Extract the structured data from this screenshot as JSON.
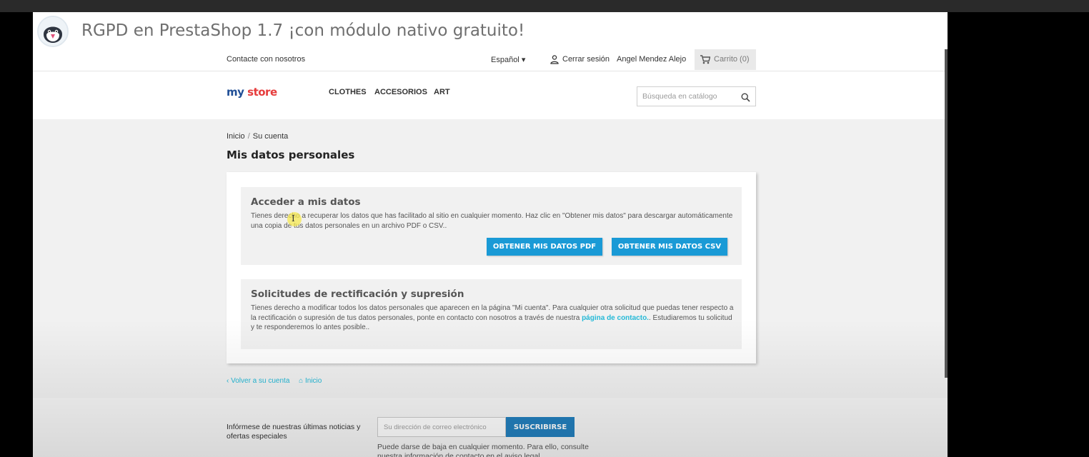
{
  "overlay": {
    "title": "RGPD en PrestaShop 1.7 ¡con módulo nativo gratuito!"
  },
  "header": {
    "contact": "Contacte con nosotros",
    "language": "Español",
    "logout": "Cerrar sesión",
    "user_name": "Angel Mendez Alejo",
    "cart": "Carrito (0)"
  },
  "logo": {
    "part1": "my ",
    "part2": "store"
  },
  "menu": {
    "items": [
      "CLOTHES",
      "ACCESORIOS",
      "ART"
    ]
  },
  "search": {
    "placeholder": "Búsqueda en catálogo"
  },
  "breadcrumb": {
    "home": "Inicio",
    "separator": "/",
    "current": "Su cuenta"
  },
  "page": {
    "title": "Mis datos personales"
  },
  "access": {
    "title": "Acceder a mis datos",
    "text": "Tienes derecho a recuperar los datos que has facilitado al sitio en cualquier momento. Haz clic en \"Obtener mis datos\" para descargar automáticamente una copia de tus datos personales en un archivo PDF o CSV..",
    "btn_pdf": "OBTENER MIS DATOS PDF",
    "btn_csv": "OBTENER MIS DATOS CSV"
  },
  "rectification": {
    "title": "Solicitudes de rectificación y supresión",
    "text_before": "Tienes derecho a modificar todos los datos personales que aparecen en la página \"Mi cuenta\". Para cualquier otra solicitud que puedas tener respecto a la rectificación o supresión de tus datos personales, ponte en contacto con nosotros a través de nuestra ",
    "link": "página de contacto.",
    "text_after": ". Estudiaremos tu solicitud y te responderemos lo antes posible.."
  },
  "footer_links": {
    "back": "‹ Volver a su cuenta",
    "home": "Inicio"
  },
  "newsletter": {
    "text": "Infórmese de nuestras últimas noticias y ofertas especiales",
    "placeholder": "Su dirección de correo electrónico",
    "button": "SUSCRIBIRSE",
    "note": "Puede darse de baja en cualquier momento. Para ello, consulte nuestra información de contacto en el aviso legal."
  },
  "colors": {
    "accent": "#1a9ad6",
    "link": "#24b9d7",
    "logo_blue": "#1f4e96",
    "logo_red": "#e63c3c"
  }
}
